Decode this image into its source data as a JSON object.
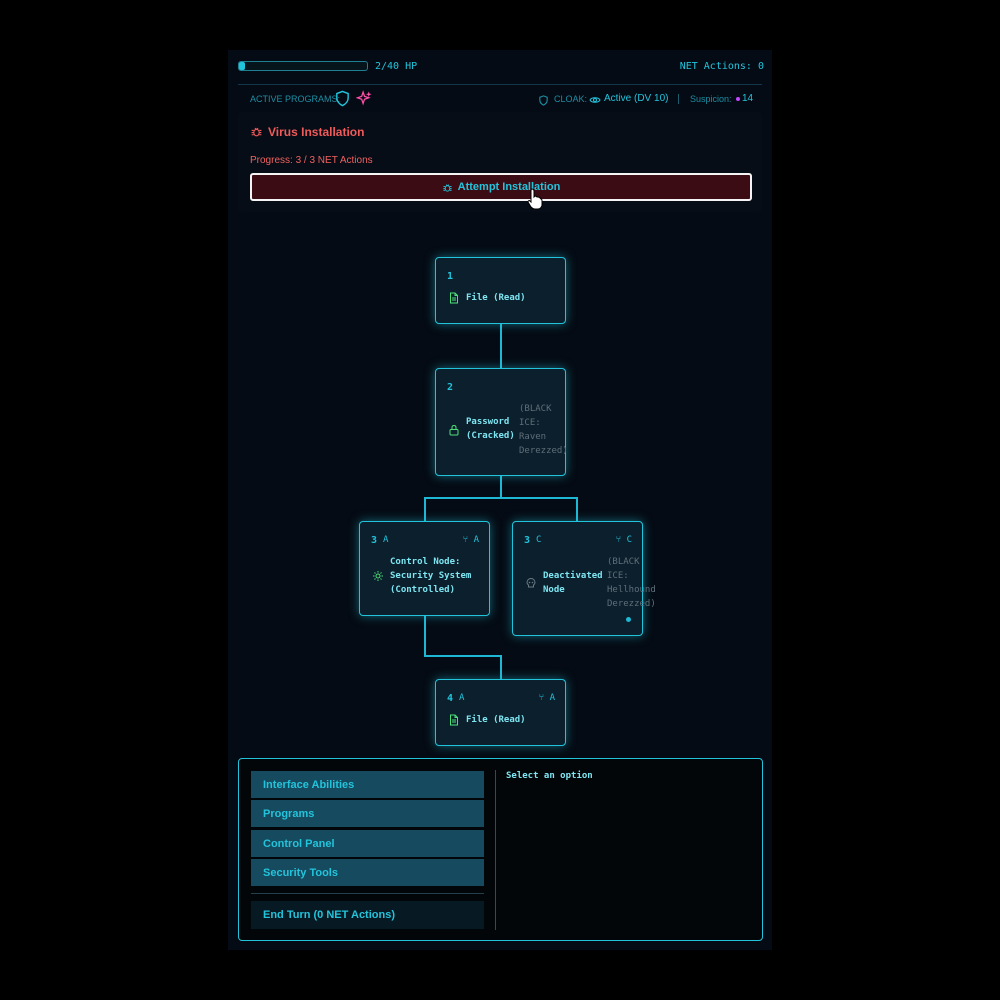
{
  "header": {
    "hp": {
      "current": 2,
      "max": 40,
      "text": "2/40 HP"
    },
    "net_actions": "NET Actions: 0"
  },
  "status": {
    "programs_label": "ACTIVE PROGRAMS:",
    "program_icons": [
      "shield-icon",
      "sparkle-icon"
    ],
    "cloak_label": "CLOAK:",
    "cloak_value": "Active (DV 10)",
    "suspicion_label": "Suspicion:",
    "suspicion_value": "14"
  },
  "virus": {
    "title": "Virus Installation",
    "progress": "Progress: 3 / 3 NET Actions",
    "button_label": "Attempt Installation"
  },
  "nodes": {
    "n1": {
      "num": "1",
      "label": "File (Read)",
      "icon": "file-icon"
    },
    "n2": {
      "num": "2",
      "label": "Password\n(Cracked)",
      "ice": "(BLACK\nICE:\nRaven\nDerezzed)",
      "icon": "lock-icon"
    },
    "n3a": {
      "num": "3",
      "letter": "A",
      "branch": "A",
      "label": "Control Node:\nSecurity System\n(Controlled)",
      "icon": "gear-icon"
    },
    "n3c": {
      "num": "3",
      "letter": "C",
      "branch": "C",
      "label": "Deactivated\nNode",
      "ice": "(BLACK\nICE:\nHellhound\nDerezzed)",
      "icon": "skull-icon"
    },
    "n4": {
      "num": "4",
      "letter": "A",
      "branch": "A",
      "label": "File (Read)",
      "icon": "file-icon"
    }
  },
  "menu": {
    "items": [
      "Interface Abilities",
      "Programs",
      "Control Panel",
      "Security Tools"
    ],
    "end_turn": "End Turn (0 NET Actions)",
    "prompt": "Select an option"
  },
  "colors": {
    "accent": "#22c4dc",
    "danger": "#f05a5a",
    "good": "#4ee07a",
    "suspicion": "#c048ff"
  }
}
